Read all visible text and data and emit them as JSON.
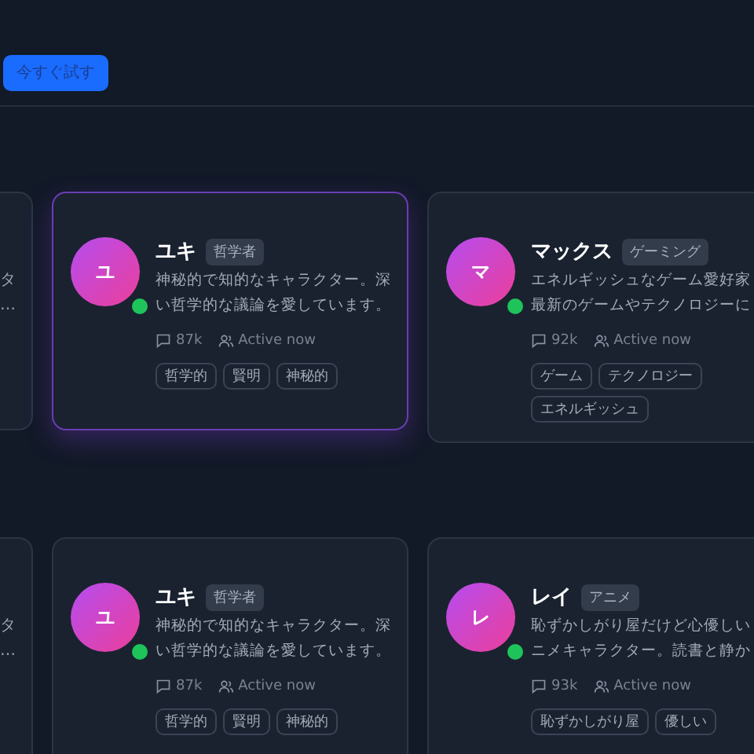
{
  "header": {
    "button": "今すぐ試す"
  },
  "rows": [
    {
      "partial_card": {
        "desc_lines": [
          "タ",
          "…"
        ]
      },
      "cards": [
        {
          "initial": "ユ",
          "online": true,
          "selected": true,
          "name": "ユキ",
          "badge": "哲学者",
          "desc_lines": [
            "神秘的で知的なキャラクター。深",
            "い哲学的な議論を愛しています。"
          ],
          "chats": "87k",
          "activity": "Active now",
          "tags": [
            "哲学的",
            "賢明",
            "神秘的"
          ]
        },
        {
          "initial": "マ",
          "online": true,
          "selected": false,
          "name": "マックス",
          "badge": "ゲーミング",
          "desc_lines": [
            "エネルギッシュなゲーム愛好家",
            "最新のゲームやテクノロジーに"
          ],
          "chats": "92k",
          "activity": "Active now",
          "tags": [
            "ゲーム",
            "テクノロジー",
            "エネルギッシュ"
          ]
        }
      ]
    },
    {
      "partial_card": {
        "desc_lines": [
          "タ",
          "…"
        ]
      },
      "cards": [
        {
          "initial": "ユ",
          "online": true,
          "selected": false,
          "name": "ユキ",
          "badge": "哲学者",
          "desc_lines": [
            "神秘的で知的なキャラクター。深",
            "い哲学的な議論を愛しています。"
          ],
          "chats": "87k",
          "activity": "Active now",
          "tags": [
            "哲学的",
            "賢明",
            "神秘的"
          ]
        },
        {
          "initial": "レ",
          "online": true,
          "selected": false,
          "name": "レイ",
          "badge": "アニメ",
          "desc_lines": [
            "恥ずかしがり屋だけど心優しい",
            "ニメキャラクター。読書と静か"
          ],
          "chats": "93k",
          "activity": "Active now",
          "tags": [
            "恥ずかしがり屋",
            "優しい"
          ]
        }
      ]
    }
  ]
}
